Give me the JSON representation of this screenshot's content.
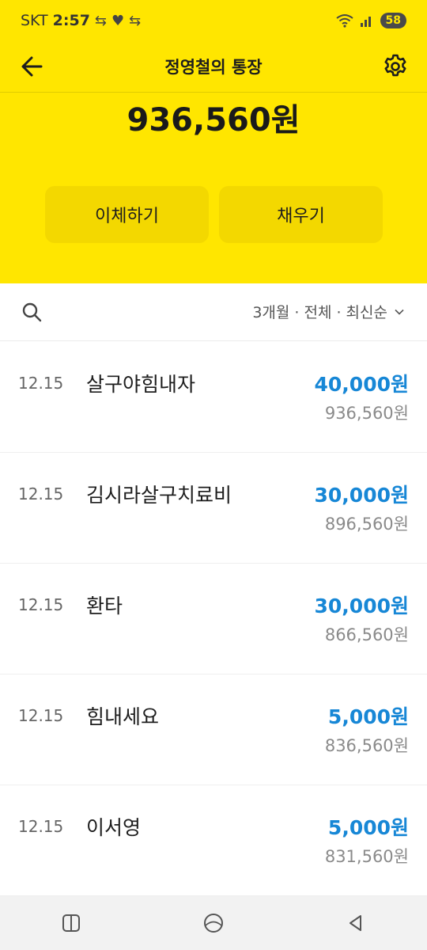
{
  "status_bar": {
    "carrier": "SKT",
    "time": "2:57",
    "battery": "58",
    "icons": [
      "sync-icon",
      "heart-icon",
      "sync-icon",
      "wifi-icon",
      "signal-icon",
      "battery-icon"
    ]
  },
  "header": {
    "title": "정영철의 통장",
    "back_icon": "back-arrow-icon",
    "settings_icon": "gear-icon"
  },
  "account": {
    "balance": "936,560원"
  },
  "actions": {
    "transfer_label": "이체하기",
    "fill_label": "채우기"
  },
  "filter": {
    "label": "3개월 · 전체 · 최신순",
    "search_icon": "search-icon"
  },
  "transactions": [
    {
      "date": "12.15",
      "name": "살구야힘내자",
      "amount": "40,000원",
      "balance": "936,560원"
    },
    {
      "date": "12.15",
      "name": "김시라살구치료비",
      "amount": "30,000원",
      "balance": "896,560원"
    },
    {
      "date": "12.15",
      "name": "환타",
      "amount": "30,000원",
      "balance": "866,560원"
    },
    {
      "date": "12.15",
      "name": "힘내세요",
      "amount": "5,000원",
      "balance": "836,560원"
    },
    {
      "date": "12.15",
      "name": "이서영",
      "amount": "5,000원",
      "balance": "831,560원"
    }
  ],
  "colors": {
    "brand_yellow": "#FFE600",
    "button_yellow": "#F3D800",
    "amount_blue": "#1787D6"
  },
  "nav": {
    "icons": [
      "recent-apps-icon",
      "home-icon",
      "back-icon"
    ]
  }
}
